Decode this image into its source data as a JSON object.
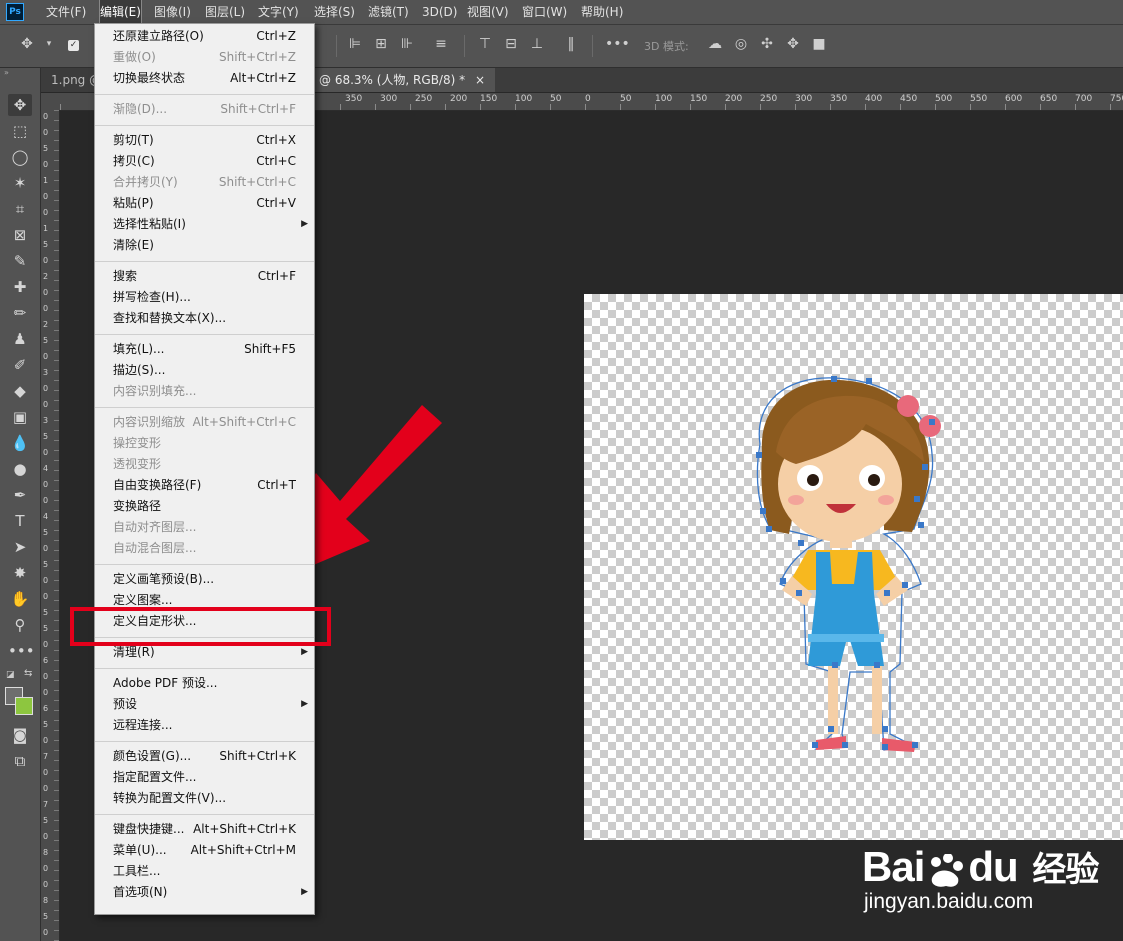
{
  "app": {
    "logo_text": "Ps"
  },
  "menubar": {
    "items": [
      "文件(F)",
      "编辑(E)",
      "图像(I)",
      "图层(L)",
      "文字(Y)",
      "选择(S)",
      "滤镜(T)",
      "3D(D)",
      "视图(V)",
      "窗口(W)",
      "帮助(H)"
    ],
    "active_index": 1
  },
  "options_bar": {
    "mode_3d_label": "3D 模式:"
  },
  "tabs": [
    {
      "label": "1.png @",
      "close": "×"
    },
    {
      "label": "@ 68.3% (人物, RGB/8) *",
      "close": "×"
    }
  ],
  "ruler": {
    "h_ticks": [
      "150",
      "100",
      "50",
      "0",
      "50",
      "100",
      "150",
      "200",
      "250",
      "300",
      "350",
      "400",
      "450",
      "500",
      "550",
      "600",
      "650",
      "700",
      "750"
    ],
    "h_ticks_left": [
      "350",
      "300",
      "250",
      "200"
    ],
    "v_digits": [
      "0",
      "0",
      "5",
      "0",
      "1",
      "0",
      "0",
      "1",
      "5",
      "0",
      "2",
      "0",
      "0",
      "2",
      "5",
      "0",
      "3",
      "0",
      "0",
      "3",
      "5",
      "0",
      "4",
      "0",
      "0",
      "4",
      "5",
      "0",
      "5",
      "0",
      "0",
      "5",
      "5",
      "0",
      "6",
      "0",
      "0",
      "6",
      "5",
      "0",
      "7",
      "0",
      "0",
      "7",
      "5",
      "0",
      "8",
      "0",
      "0",
      "8",
      "5",
      "0"
    ]
  },
  "edit_menu": {
    "groups": [
      [
        {
          "label": "还原建立路径(O)",
          "shortcut": "Ctrl+Z",
          "disabled": false
        },
        {
          "label": "重做(O)",
          "shortcut": "Shift+Ctrl+Z",
          "disabled": true
        },
        {
          "label": "切换最终状态",
          "shortcut": "Alt+Ctrl+Z",
          "disabled": false
        }
      ],
      [
        {
          "label": "渐隐(D)...",
          "shortcut": "Shift+Ctrl+F",
          "disabled": true
        }
      ],
      [
        {
          "label": "剪切(T)",
          "shortcut": "Ctrl+X",
          "disabled": false
        },
        {
          "label": "拷贝(C)",
          "shortcut": "Ctrl+C",
          "disabled": false
        },
        {
          "label": "合并拷贝(Y)",
          "shortcut": "Shift+Ctrl+C",
          "disabled": true
        },
        {
          "label": "粘贴(P)",
          "shortcut": "Ctrl+V",
          "disabled": false
        },
        {
          "label": "选择性粘贴(I)",
          "shortcut": "",
          "disabled": false,
          "submenu": true
        },
        {
          "label": "清除(E)",
          "shortcut": "",
          "disabled": false
        }
      ],
      [
        {
          "label": "搜索",
          "shortcut": "Ctrl+F",
          "disabled": false
        },
        {
          "label": "拼写检查(H)...",
          "shortcut": "",
          "disabled": false
        },
        {
          "label": "查找和替换文本(X)...",
          "shortcut": "",
          "disabled": false
        }
      ],
      [
        {
          "label": "填充(L)...",
          "shortcut": "Shift+F5",
          "disabled": false
        },
        {
          "label": "描边(S)...",
          "shortcut": "",
          "disabled": false
        },
        {
          "label": "内容识别填充...",
          "shortcut": "",
          "disabled": true
        }
      ],
      [
        {
          "label": "内容识别缩放",
          "shortcut": "Alt+Shift+Ctrl+C",
          "disabled": true
        },
        {
          "label": "操控变形",
          "shortcut": "",
          "disabled": true
        },
        {
          "label": "透视变形",
          "shortcut": "",
          "disabled": true
        },
        {
          "label": "自由变换路径(F)",
          "shortcut": "Ctrl+T",
          "disabled": false
        },
        {
          "label": "变换路径",
          "shortcut": "",
          "disabled": false
        },
        {
          "label": "自动对齐图层...",
          "shortcut": "",
          "disabled": true
        },
        {
          "label": "自动混合图层...",
          "shortcut": "",
          "disabled": true
        }
      ],
      [
        {
          "label": "定义画笔预设(B)...",
          "shortcut": "",
          "disabled": false
        },
        {
          "label": "定义图案...",
          "shortcut": "",
          "disabled": false
        },
        {
          "label": "定义自定形状...",
          "shortcut": "",
          "disabled": false
        }
      ],
      [
        {
          "label": "清理(R)",
          "shortcut": "",
          "disabled": false,
          "submenu": true
        }
      ],
      [
        {
          "label": "Adobe PDF 预设...",
          "shortcut": "",
          "disabled": false
        },
        {
          "label": "预设",
          "shortcut": "",
          "disabled": false,
          "submenu": true
        },
        {
          "label": "远程连接...",
          "shortcut": "",
          "disabled": false
        }
      ],
      [
        {
          "label": "颜色设置(G)...",
          "shortcut": "Shift+Ctrl+K",
          "disabled": false
        },
        {
          "label": "指定配置文件...",
          "shortcut": "",
          "disabled": false
        },
        {
          "label": "转换为配置文件(V)...",
          "shortcut": "",
          "disabled": false
        }
      ],
      [
        {
          "label": "键盘快捷键...",
          "shortcut": "Alt+Shift+Ctrl+K",
          "disabled": false
        },
        {
          "label": "菜单(U)...",
          "shortcut": "Alt+Shift+Ctrl+M",
          "disabled": false
        },
        {
          "label": "工具栏...",
          "shortcut": "",
          "disabled": false
        },
        {
          "label": "首选项(N)",
          "shortcut": "",
          "disabled": false,
          "submenu": true
        }
      ]
    ],
    "highlighted_label": "定义自定形状..."
  },
  "annotation": {
    "color": "#e3001b"
  },
  "watermark": {
    "brand": "Bai",
    "brand2": "du",
    "cn": "经验",
    "url": "jingyan.baidu.com"
  },
  "colors": {
    "fg_swatch": "#6e6e6e",
    "bg_swatch": "#8dc63f"
  }
}
